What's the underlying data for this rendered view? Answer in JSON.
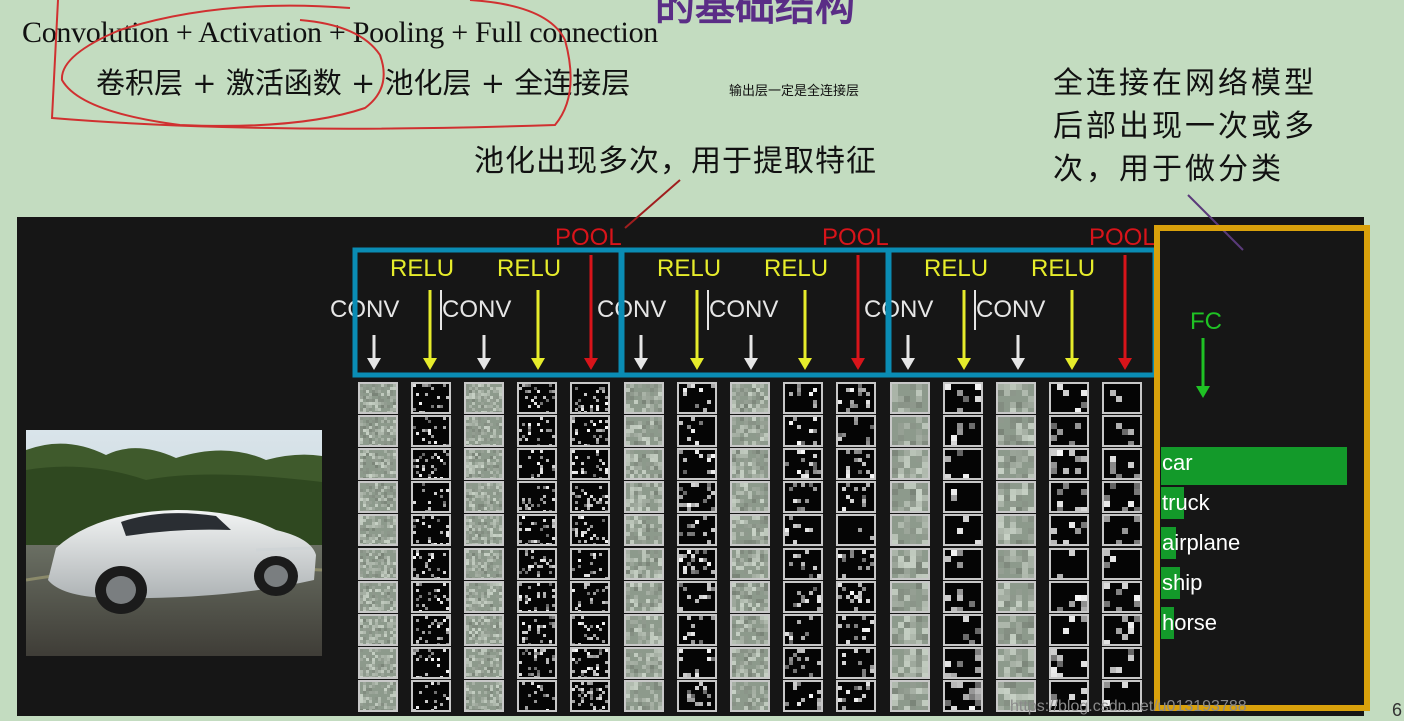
{
  "top_title": "的基础结构",
  "formula_en": "Convolution + Activation + Pooling  + Full connection",
  "formula_cn": "卷积层 + 激活函数 + 池化层  + 全连接层",
  "formula_note": "输出层一定是全连接层",
  "pool_note": "池化出现多次，用于提取特征",
  "fc_note": [
    "全连接在网络模型",
    "后部出现一次或多",
    "次，用于做分类"
  ],
  "diagram": {
    "pool_label": "POOL",
    "relu_label": "RELU",
    "conv_label": "CONV",
    "fc_label": "FC",
    "blocks": [
      {
        "id": 1,
        "layers": [
          "CONV",
          "RELU",
          "CONV",
          "RELU",
          "POOL"
        ]
      },
      {
        "id": 2,
        "layers": [
          "CONV",
          "RELU",
          "CONV",
          "RELU",
          "POOL"
        ]
      },
      {
        "id": 3,
        "layers": [
          "CONV",
          "RELU",
          "CONV",
          "RELU",
          "POOL"
        ]
      }
    ],
    "classes": [
      {
        "name": "car",
        "score": 0.98
      },
      {
        "name": "truck",
        "score": 0.12
      },
      {
        "name": "airplane",
        "score": 0.08
      },
      {
        "name": "ship",
        "score": 0.1
      },
      {
        "name": "horse",
        "score": 0.07
      }
    ],
    "colors": {
      "conv_box": "#0a8cb4",
      "fc_box": "#d9a10b",
      "pool": "#d8141a",
      "relu": "#e6ec2b",
      "conv": "#e6e6e6",
      "fc": "#1fc224",
      "annotation_ink": "#d03030"
    }
  },
  "watermark": "https://blog.csdn.net/u013193788",
  "page_number": "6"
}
